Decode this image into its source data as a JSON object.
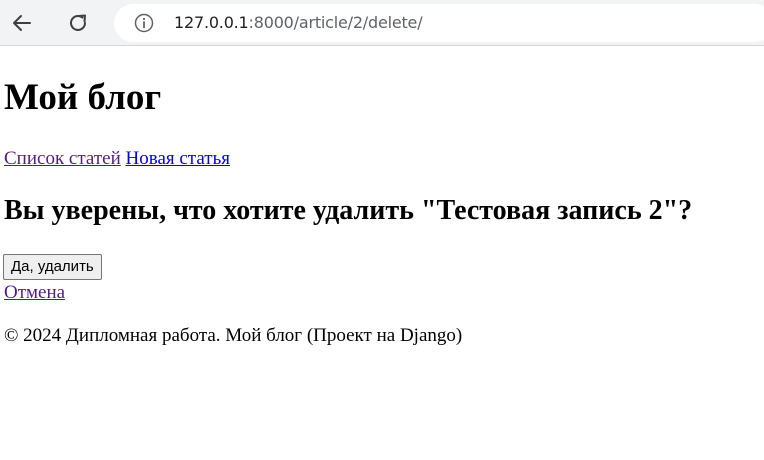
{
  "browser": {
    "url_host": "127.0.0.1",
    "url_rest": ":8000/article/2/delete/",
    "back_icon": "arrow-left-icon",
    "reload_icon": "reload-icon",
    "info_icon": "info-icon"
  },
  "page": {
    "site_title": "Мой блог",
    "nav": {
      "articles_list": "Список статей",
      "new_article": "Новая статья"
    },
    "confirm_heading": "Вы уверены, что хотите удалить \"Тестовая запись 2\"?",
    "delete_button": "Да, удалить",
    "cancel_link": "Отмена",
    "footer": "© 2024 Дипломная работа. Мой блог (Проект на Django)"
  },
  "colors": {
    "link_visited": "#551a8b",
    "link_unvisited": "#0000ee"
  }
}
